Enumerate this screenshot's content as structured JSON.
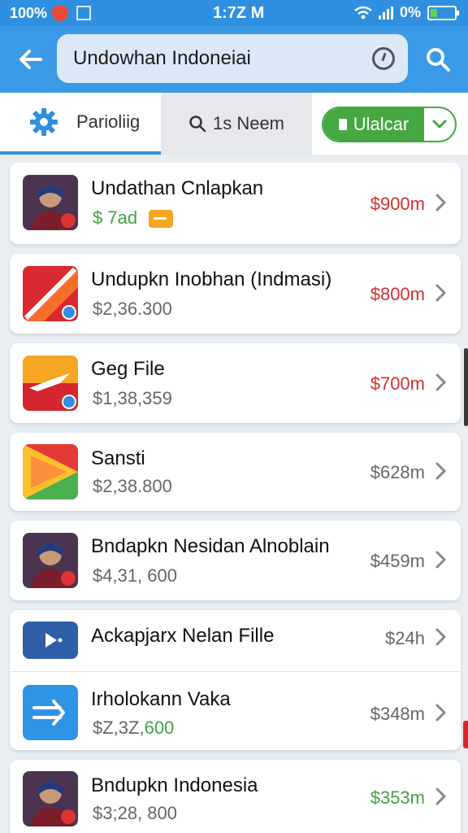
{
  "status_bar": {
    "battery_percent_left": "100%",
    "time": "1:7Z M",
    "battery_percent_right": "0%"
  },
  "app_bar": {
    "search_value": "Undowhan Indoneiai",
    "icons": [
      "back-arrow-icon",
      "clock-icon",
      "search-icon"
    ]
  },
  "tabs": {
    "active_label": "Parioliig",
    "middle_label": "1s  Neem",
    "filter_label": "Ulalcar"
  },
  "colors": {
    "accent": "#3b9ae8",
    "price_red": "#d32f2f",
    "price_gray": "#666666",
    "price_green": "#43a047",
    "filter_green": "#46a840"
  },
  "items": [
    {
      "title": "Undathan Cnlapkan",
      "subtitle": "$ 7ad",
      "price": "$900m",
      "price_color": "#d32f2f",
      "icon": "avatar-photo"
    },
    {
      "title": "Undupkn Inobhan (Indmasi)",
      "subtitle": "$2,36.300",
      "price": "$800m",
      "price_color": "#d32f2f",
      "icon": "red-diagonal-app-icon"
    },
    {
      "title": "Geg File",
      "subtitle": "$1,38,359",
      "price": "$700m",
      "price_color": "#d32f2f",
      "icon": "plane-app-icon"
    },
    {
      "title": "Sansti",
      "subtitle": "$2,38.800",
      "price": "$628m",
      "price_color": "#666666",
      "icon": "play-arrow-app-icon"
    },
    {
      "title": "Bndapkn Nesidan Alnoblain",
      "subtitle": "$4,31, 600",
      "price": "$459m",
      "price_color": "#666666",
      "icon": "avatar-photo"
    },
    {
      "title": "Ackapjarx Nelan Fille",
      "subtitle": "",
      "price": "$24h",
      "price_color": "#666666",
      "icon": "video-app-icon"
    },
    {
      "title": "Irholokann Vaka",
      "subtitle_prefix": "$Z,3Z,",
      "subtitle_suffix": "600",
      "price": "$348m",
      "price_color": "#666666",
      "icon": "arrow-app-icon"
    },
    {
      "title": "Bndupkn Indonesia",
      "subtitle": "$3;28, 800",
      "price": "$353m",
      "price_color": "#43a047",
      "icon": "avatar-photo"
    }
  ]
}
